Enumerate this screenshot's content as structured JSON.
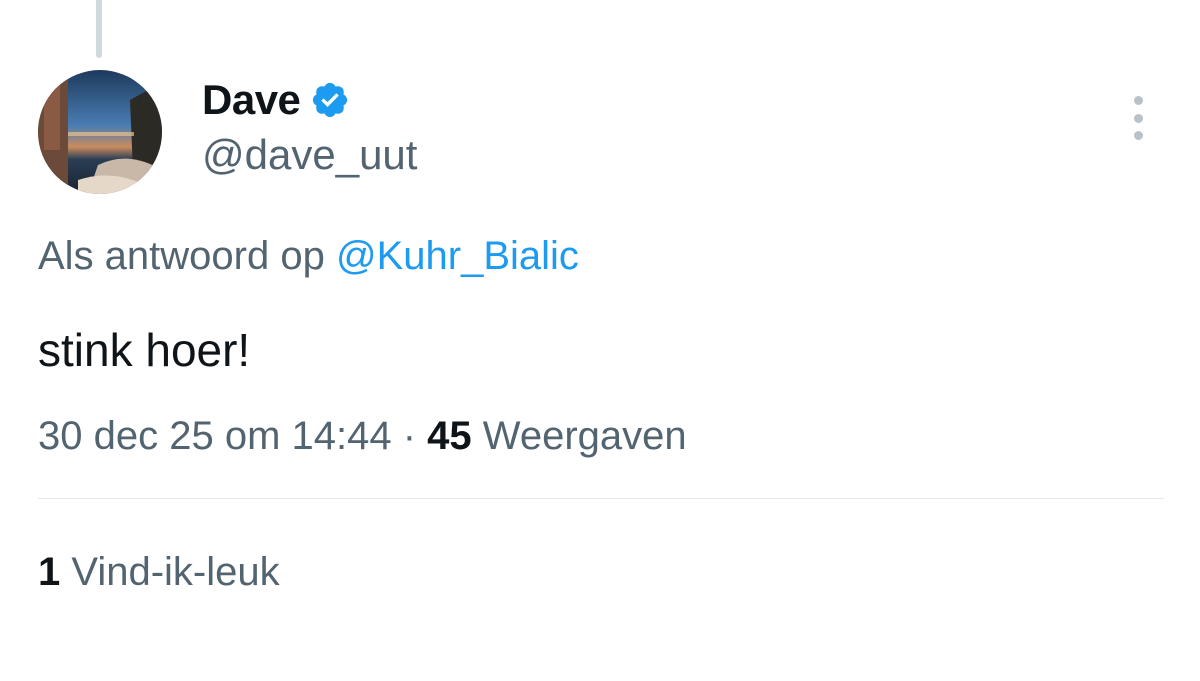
{
  "author": {
    "display_name": "Dave",
    "handle": "@dave_uut",
    "verified_icon": "verified-badge-icon",
    "avatar": "profile-photo"
  },
  "menu": {
    "icon": "more-options-icon"
  },
  "reply": {
    "prefix": "Als antwoord op",
    "target": "@Kuhr_Bialic"
  },
  "tweet": {
    "text": "stink hoer!"
  },
  "meta": {
    "timestamp": "30 dec 25 om 14:44",
    "separator": "·",
    "views_count": "45",
    "views_label": "Weergaven"
  },
  "engagement": {
    "likes_count": "1",
    "likes_label": "Vind-ik-leuk"
  },
  "colors": {
    "accent": "#1d9bf0",
    "secondary_text": "#536471",
    "primary_text": "#0f1419"
  }
}
